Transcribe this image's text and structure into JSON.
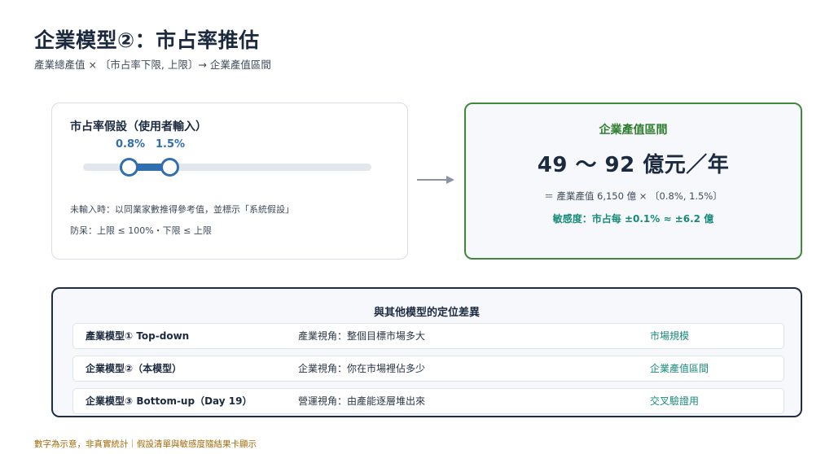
{
  "header": {
    "title": "企業模型②：市占率推估",
    "subtitle": "產業總產值 × 〔市占率下限, 上限〕→ 企業產值區間"
  },
  "slider_card": {
    "heading": "市占率假設（使用者輸入）",
    "low_label": "0.8%",
    "high_label": "1.5%",
    "range_min": 0,
    "range_max": 5,
    "low_value": 0.8,
    "high_value": 1.5,
    "note_default": "未輸入時：以同業家數推得參考值，並標示「系統假設」",
    "note_guard": "防呆：上限 ≤ 100%・下限 ≤ 上限"
  },
  "result": {
    "heading": "企業產值區間",
    "range": "49 ～ 92 億元／年",
    "formula": "＝ 產業產值 6,150 億 × 〔0.8%, 1.5%〕",
    "sensitivity": "敏感度：市占每 ±0.1% ≈ ±6.2 億"
  },
  "comparison": {
    "heading": "與其他模型的定位差異",
    "rows": [
      {
        "model": "產業模型① Top-down",
        "view": "產業視角：整個目標市場多大",
        "output": "市場規模"
      },
      {
        "model": "企業模型②（本模型）",
        "view": "企業視角：你在市場裡佔多少",
        "output": "企業產值區間"
      },
      {
        "model": "企業模型③ Bottom-up（Day 19）",
        "view": "營運視角：由產能逐層堆出來",
        "output": "交叉驗證用"
      }
    ]
  },
  "footer": "數字為示意，非真實統計｜假設清單與敏感度隨結果卡顯示",
  "colors": {
    "accent_blue": "#2f6fb0",
    "accent_green": "#3f8a3a",
    "teal": "#188a7a",
    "navy": "#1f2d4d",
    "footer": "#a36a08"
  }
}
